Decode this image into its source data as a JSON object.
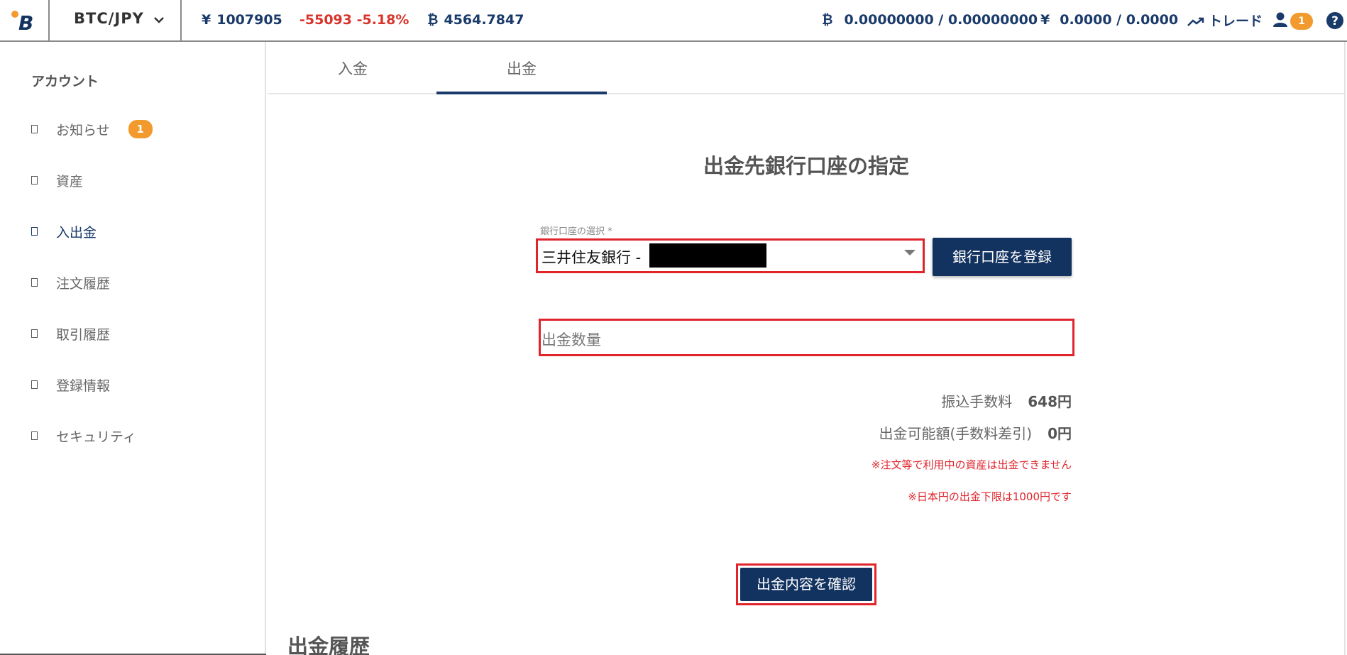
{
  "header": {
    "pair": "BTC/JPY",
    "price": "1007905",
    "price_symbol": "¥",
    "change": "-55093 -5.18%",
    "change_symbol": "",
    "volume": "4564.7847",
    "volume_symbol": "₿",
    "btc_balance": "0.00000000 / 0.00000000",
    "btc_symbol": "₿",
    "jpy_balance": "0.0000 / 0.0000",
    "jpy_symbol": "¥",
    "trade_label": "トレード",
    "notification_count": "1"
  },
  "sidebar": {
    "title": "アカウント",
    "items": [
      {
        "label": "お知らせ",
        "badge": "1"
      },
      {
        "label": "資産"
      },
      {
        "label": "入出金",
        "active": true
      },
      {
        "label": "注文履歴"
      },
      {
        "label": "取引履歴"
      },
      {
        "label": "登録情報"
      },
      {
        "label": "セキュリティ"
      }
    ]
  },
  "tabs": [
    {
      "label": "入金"
    },
    {
      "label": "出金",
      "active": true
    }
  ],
  "form": {
    "title": "出金先銀行口座の指定",
    "bank_label": "銀行口座の選択 *",
    "bank_value": "三井住友銀行 -",
    "register_button": "銀行口座を登録",
    "amount_placeholder": "出金数量",
    "fee_label": "振込手数料",
    "fee_value": "648円",
    "available_label": "出金可能額(手数料差引)",
    "available_value": "0円",
    "note1": "※注文等で利用中の資産は出金できません",
    "note2": "※日本円の出金下限は1000円です",
    "confirm_button": "出金内容を確認"
  },
  "history": {
    "title": "出金履歴"
  },
  "colors": {
    "navy": "#12325f",
    "accent_orange": "#f29a2e",
    "highlight_red": "#e0242c",
    "negative_red": "#d9332b"
  }
}
